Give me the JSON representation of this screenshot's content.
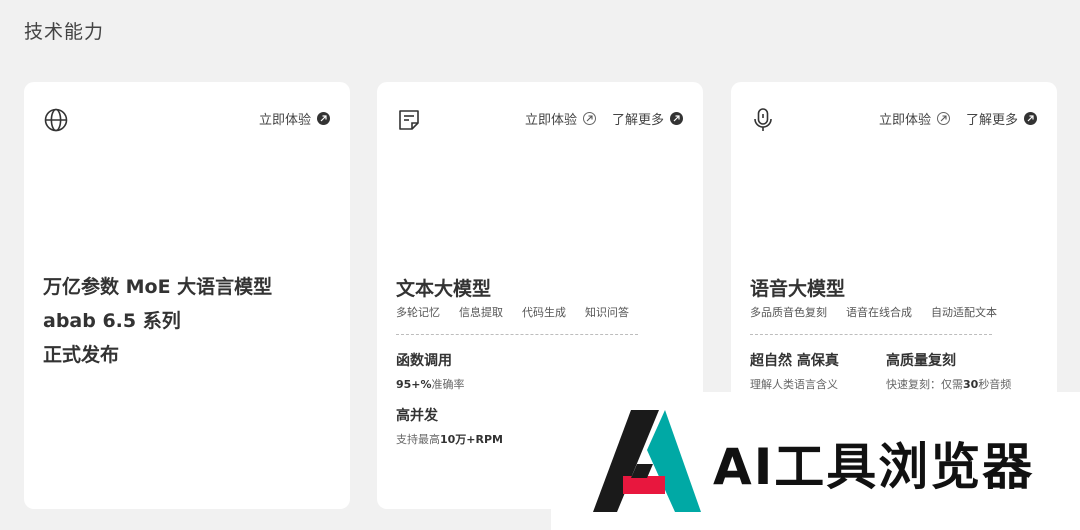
{
  "section_title": "技术能力",
  "cards": [
    {
      "icon": "globe-icon",
      "links": [
        {
          "label": "立即体验",
          "style": "solid"
        }
      ],
      "title_lines": [
        "万亿参数 MoE 大语言模型",
        "abab 6.5 系列",
        "正式发布"
      ]
    },
    {
      "icon": "document-icon",
      "links": [
        {
          "label": "立即体验",
          "style": "outline"
        },
        {
          "label": "了解更多",
          "style": "solid"
        }
      ],
      "title": "文本大模型",
      "tags": [
        "多轮记忆",
        "信息提取",
        "代码生成",
        "知识问答"
      ],
      "features": [
        {
          "title": "函数调用",
          "desc_bold": "95+%",
          "desc_rest": "准确率"
        },
        {
          "title": "高并发",
          "desc_pre": "支持最高",
          "desc_bold": "10万+RPM"
        }
      ]
    },
    {
      "icon": "microphone-icon",
      "links": [
        {
          "label": "立即体验",
          "style": "outline"
        },
        {
          "label": "了解更多",
          "style": "solid"
        }
      ],
      "title": "语音大模型",
      "tags": [
        "多品质音色复刻",
        "语音在线合成",
        "自动适配文本"
      ],
      "features": [
        {
          "title": "超自然 高保真",
          "desc": "理解人类语言含义"
        },
        {
          "title": "高质量复刻",
          "desc_pre": "快速复刻：仅需",
          "desc_bold": "30",
          "desc_rest": "秒音频"
        }
      ]
    }
  ],
  "watermark": {
    "text": "AI工具浏览器",
    "colors": {
      "black": "#1a1a1a",
      "red": "#e8173e",
      "teal": "#00a9a5"
    }
  }
}
